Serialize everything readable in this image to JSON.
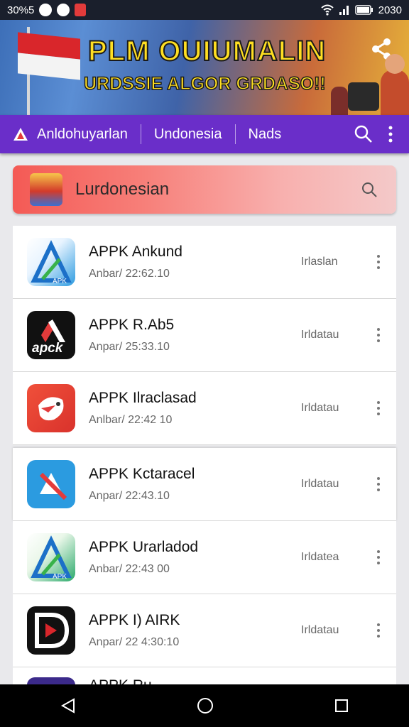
{
  "status_bar": {
    "left_text": "30%5",
    "right_text": "2030"
  },
  "banner": {
    "title": "PLM OUIUMALIN",
    "subtitle": "URDSSIE ALGOR GRDASO!!"
  },
  "nav": {
    "items": [
      {
        "label": "Anldohuyarlan"
      },
      {
        "label": "Undonesia"
      },
      {
        "label": "Nads"
      }
    ]
  },
  "search": {
    "text": "Lurdonesian"
  },
  "apps": [
    {
      "name": "APPK Ankund",
      "date": "Anbar/ 22:62.10",
      "status": "Irlaslan",
      "icon": "triangle-arrow-app-icon"
    },
    {
      "name": "APPK R.Ab5",
      "date": "Anpar/ 25:33.10",
      "status": "Irldatau",
      "icon": "apck-black-app-icon"
    },
    {
      "name": "APPK Ilraclasad",
      "date": "Anlbar/ 22:42 10",
      "status": "Irldatau",
      "icon": "red-bird-app-icon"
    },
    {
      "name": "APPK Kctaracel",
      "date": "Anpar/ 22:43.10",
      "status": "Irldatau",
      "icon": "blue-slash-app-icon"
    },
    {
      "name": "APPK Urarladod",
      "date": "Anbar/ 22:43 00",
      "status": "Irldatea",
      "icon": "triangle-arrow-app-icon"
    },
    {
      "name": "APPK I) AIRK",
      "date": "Anpar/ 22 4:30:10",
      "status": "Irldatau",
      "icon": "play-d-app-icon"
    },
    {
      "name": "APPK Ru",
      "date": "",
      "status": "",
      "icon": "purple-app-icon"
    }
  ],
  "apck_icon_text": "apck",
  "apk_icon_text": "APK",
  "colors": {
    "nav": "#6a2ec9",
    "search_start": "#f45a55",
    "search_end": "#f4c9c9",
    "status_bar": "#1a1f2c"
  }
}
